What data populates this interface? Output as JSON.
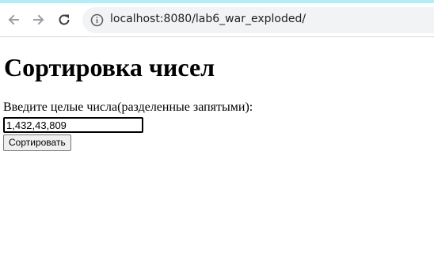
{
  "browser": {
    "url": "localhost:8080/lab6_war_exploded/",
    "icons": {
      "back": "arrow-left-icon",
      "forward": "arrow-right-icon",
      "reload": "reload-icon",
      "site_info": "info-icon"
    }
  },
  "page": {
    "title": "Сортировка чисел",
    "input_label": "Введите целые числа(разделенные запятыми):",
    "input_value": "1,432,43,809",
    "sort_button_label": "Сортировать"
  }
}
